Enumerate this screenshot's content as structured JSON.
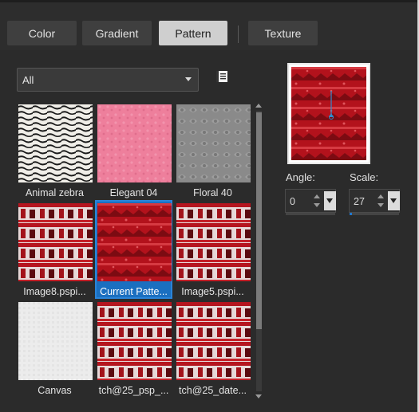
{
  "tabs": [
    {
      "label": "Color",
      "active": false
    },
    {
      "label": "Gradient",
      "active": false
    },
    {
      "label": "Pattern",
      "active": true
    },
    {
      "label": "Texture",
      "active": false
    }
  ],
  "filter": {
    "selected": "All",
    "library_icon": "library-list-icon"
  },
  "patterns": [
    {
      "name": "Animal zebra",
      "style": "zebra"
    },
    {
      "name": "Elegant 04",
      "style": "pink"
    },
    {
      "name": "Floral 40",
      "style": "gray"
    },
    {
      "name": "Image8.pspi...",
      "style": "redwhite"
    },
    {
      "name": "Current Patte...",
      "style": "red",
      "selected": true
    },
    {
      "name": "Image5.pspi...",
      "style": "redwhite"
    },
    {
      "name": "Canvas",
      "style": "canvas"
    },
    {
      "name": "tch@25_psp_...",
      "style": "redwhite"
    },
    {
      "name": "tch@25_date...",
      "style": "redwhite"
    }
  ],
  "angle": {
    "label": "Angle:",
    "value": "0"
  },
  "scale": {
    "label": "Scale:",
    "value": "27",
    "fill_fraction": 0.05
  },
  "colors": {
    "accent": "#1b6fc0",
    "pattern_red": "#b3121c"
  }
}
